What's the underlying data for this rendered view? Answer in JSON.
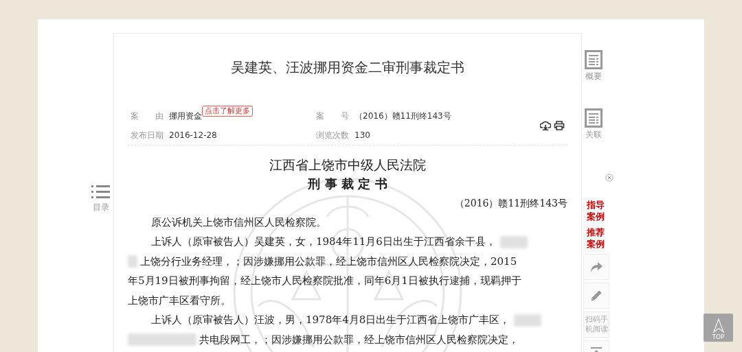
{
  "title": "吴建英、汪波挪用资金二审刑事裁定书",
  "meta": [
    {
      "label": "案　　由",
      "value": "挪用资金",
      "tag": "点击了解更多"
    },
    {
      "label": "案　　号",
      "value": "（2016）赣11刑终143号"
    },
    {
      "label": "发布日期",
      "value": "2016-12-28"
    },
    {
      "label": "浏览次数",
      "value": "130"
    }
  ],
  "document": {
    "court": "江西省上饶市中级人民法院",
    "doc_type": "刑 事 裁 定 书",
    "case_number": "（2016）赣11刑终143号",
    "lines": [
      {
        "indent": true,
        "segments": [
          {
            "kind": "text",
            "text": "原公诉机关上饶市信州区人民检察院。"
          }
        ]
      },
      {
        "indent": true,
        "segments": [
          {
            "kind": "text",
            "text": "上诉人（原审被告人）吴建英，女，1984年11月6日出生于江西省余干县，"
          },
          {
            "kind": "redacted_end"
          }
        ]
      },
      {
        "indent": false,
        "segments": [
          {
            "kind": "redacted_short"
          },
          {
            "kind": "text",
            "text": "上饶分行业务经理，；因涉嫌挪用公款罪，经上饶市信州区人民检察院决定，2015"
          }
        ]
      },
      {
        "indent": false,
        "segments": [
          {
            "kind": "text",
            "text": "年5月19日被刑事拘留，经上饶市人民检察院批准，同年6月1日被执行逮捕，现羁押于"
          }
        ]
      },
      {
        "indent": false,
        "segments": [
          {
            "kind": "text",
            "text": "上饶市广丰区看守所。"
          }
        ]
      },
      {
        "indent": true,
        "segments": [
          {
            "kind": "text",
            "text": "上诉人（原审被告人）汪波，男，1978年4月8日出生于江西省上饶市广丰区，"
          },
          {
            "kind": "redacted_end"
          }
        ]
      },
      {
        "indent": false,
        "segments": [
          {
            "kind": "redacted_long"
          },
          {
            "kind": "text",
            "text": "共电段网工，；因涉嫌挪用公款罪，经上饶市信州区人民检察院决定，"
          }
        ]
      }
    ]
  },
  "toc": {
    "label": "目录"
  },
  "side_nav": [
    {
      "label": "概要"
    },
    {
      "label": "关联"
    }
  ],
  "case_links": [
    {
      "label": "指导案例"
    },
    {
      "label": "推荐案例"
    }
  ],
  "tools": [
    {
      "kind": "share"
    },
    {
      "kind": "edit"
    },
    {
      "kind": "qr",
      "label": "扫码手机阅读"
    },
    {
      "kind": "top"
    }
  ],
  "back_to_top": {
    "label": "TOP"
  }
}
